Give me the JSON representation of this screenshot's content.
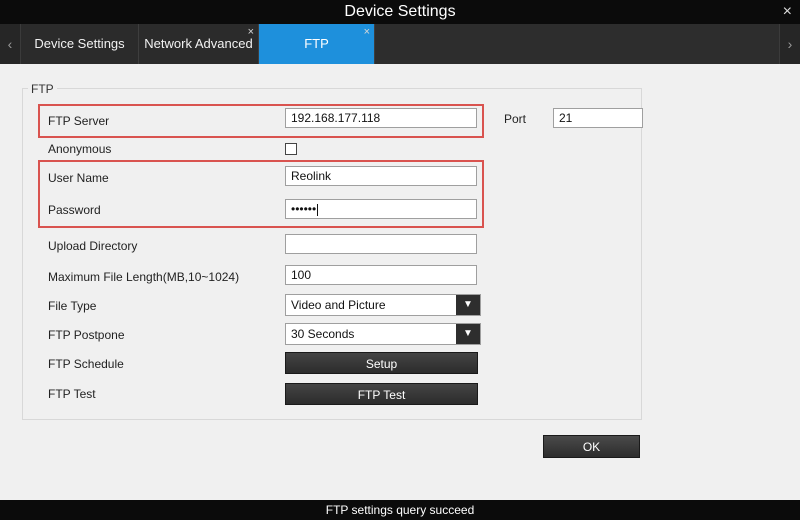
{
  "window": {
    "title": "Device Settings",
    "close_glyph": "×"
  },
  "tabs": [
    {
      "label": "Device Settings",
      "active": false,
      "close_glyph": ""
    },
    {
      "label": "Network Advanced",
      "active": false,
      "close_glyph": "×"
    },
    {
      "label": "FTP",
      "active": true,
      "close_glyph": "×"
    }
  ],
  "nav": {
    "left_glyph": "‹",
    "right_glyph": "›"
  },
  "ftp": {
    "group_title": "FTP",
    "server_label": "FTP Server",
    "server_value": "192.168.177.118",
    "port_label": "Port",
    "port_value": "21",
    "anonymous_label": "Anonymous",
    "username_label": "User Name",
    "username_value": "Reolink",
    "password_label": "Password",
    "password_value": "••••••",
    "upload_dir_label": "Upload Directory",
    "upload_dir_value": "",
    "max_file_label": "Maximum File Length(MB,10~1024)",
    "max_file_value": "100",
    "file_type_label": "File Type",
    "file_type_value": "Video and Picture",
    "postpone_label": "FTP Postpone",
    "postpone_value": "30 Seconds",
    "schedule_label": "FTP Schedule",
    "schedule_button": "Setup",
    "test_label": "FTP Test",
    "test_button": "FTP Test",
    "dropdown_glyph": "▼"
  },
  "actions": {
    "ok_label": "OK"
  },
  "status": {
    "text": "FTP  settings query succeed"
  },
  "colors": {
    "accent": "#1e90dc",
    "highlight": "#d9534f",
    "titlebar": "#0b0b0b"
  }
}
